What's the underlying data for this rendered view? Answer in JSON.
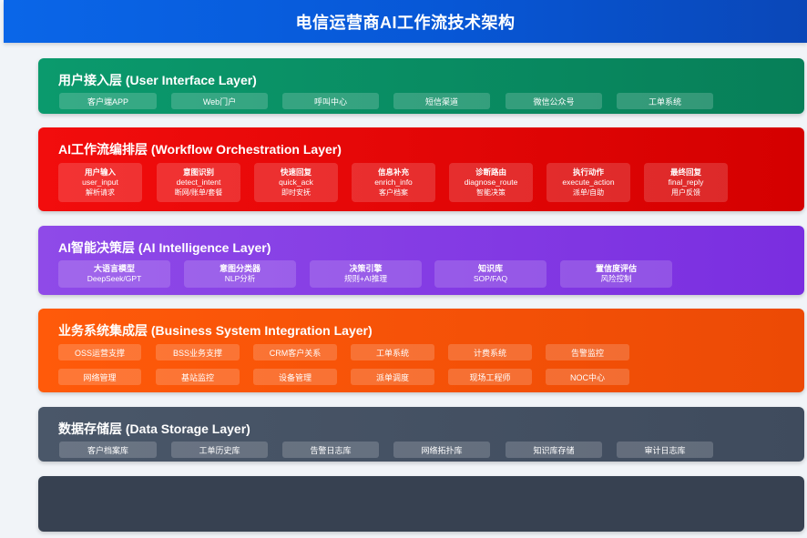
{
  "header": {
    "title": "电信运营商AI工作流技术架构"
  },
  "ui_layer": {
    "title": "用户接入层 (User Interface Layer)",
    "items": [
      "客户端APP",
      "Web门户",
      "呼叫中心",
      "短信渠道",
      "微信公众号",
      "工单系统"
    ]
  },
  "workflow_layer": {
    "title": "AI工作流编排层 (Workflow Orchestration Layer)",
    "nodes": [
      {
        "title": "用户输入",
        "code": "user_input",
        "desc": "解析请求"
      },
      {
        "title": "意图识别",
        "code": "detect_intent",
        "desc": "断网/账单/套餐"
      },
      {
        "title": "快速回复",
        "code": "quick_ack",
        "desc": "即时安抚"
      },
      {
        "title": "信息补充",
        "code": "enrich_info",
        "desc": "客户档案"
      },
      {
        "title": "诊断路由",
        "code": "diagnose_route",
        "desc": "智能决策"
      },
      {
        "title": "执行动作",
        "code": "execute_action",
        "desc": "派单/自助"
      },
      {
        "title": "最终回复",
        "code": "final_reply",
        "desc": "用户反馈"
      }
    ]
  },
  "ai_layer": {
    "title": "AI智能决策层 (AI Intelligence Layer)",
    "nodes": [
      {
        "title": "大语言模型",
        "desc": "DeepSeek/GPT"
      },
      {
        "title": "意图分类器",
        "desc": "NLP分析"
      },
      {
        "title": "决策引擎",
        "desc": "规则+AI推理"
      },
      {
        "title": "知识库",
        "desc": "SOP/FAQ"
      },
      {
        "title": "置信度评估",
        "desc": "风险控制"
      }
    ]
  },
  "business_layer": {
    "title": "业务系统集成层 (Business System Integration Layer)",
    "row1": [
      "OSS运营支撑",
      "BSS业务支撑",
      "CRM客户关系",
      "工单系统",
      "计费系统",
      "告警监控"
    ],
    "row2": [
      "网络管理",
      "基站监控",
      "设备管理",
      "派单调度",
      "现场工程师",
      "NOC中心"
    ]
  },
  "data_layer": {
    "title": "数据存储层 (Data Storage Layer)",
    "items": [
      "客户档案库",
      "工单历史库",
      "告警日志库",
      "网络拓扑库",
      "知识库存储",
      "审计日志库"
    ]
  },
  "colors": {
    "header": "#0757d6",
    "ui": "#0b9a6d",
    "workflow": "#f20d0d",
    "ai": "#8f4ae8",
    "business": "#ff5a0a",
    "data": "#4a5769",
    "empty": "#374151"
  }
}
